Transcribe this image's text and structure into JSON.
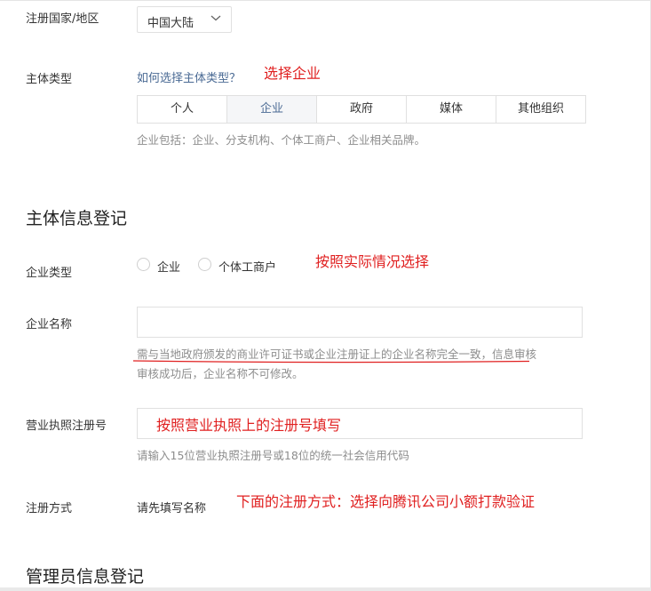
{
  "region": {
    "label": "注册国家/地区",
    "selected": "中国大陆",
    "chevron_icon": "chevron-down-icon"
  },
  "entity_type": {
    "label": "主体类型",
    "help_link": "如何选择主体类型？",
    "options": [
      "个人",
      "企业",
      "政府",
      "媒体",
      "其他组织"
    ],
    "selected": "企业",
    "hint": "企业包括：企业、分支机构、个体工商户、企业相关品牌。"
  },
  "registration": {
    "section_title": "主体信息登记",
    "company_type": {
      "label": "企业类型",
      "options": [
        "企业",
        "个体工商户"
      ]
    },
    "company_name": {
      "label": "企业名称",
      "value": "",
      "hint_line1": "需与当地政府颁发的商业许可证书或企业注册证上的企业名称完全一致，信息审核",
      "hint_line2": "审核成功后，企业名称不可修改。"
    },
    "license_number": {
      "label": "营业执照注册号",
      "value": "",
      "hint": "请输入15位营业执照注册号或18位的统一社会信用代码"
    },
    "method": {
      "label": "注册方式",
      "value": "请先填写名称"
    }
  },
  "admin_section": {
    "title": "管理员信息登记"
  },
  "annotations": {
    "choose_enterprise": "选择企业",
    "choose_by_actual": "按照实际情况选择",
    "fill_by_license": "按照营业执照上的注册号填写",
    "method_note": "下面的注册方式：选择向腾讯公司小额打款验证"
  },
  "colors": {
    "annotation_red": "#e02020",
    "link_blue": "#4a6a94",
    "hint_gray": "#8d8d8d",
    "border": "#e0e0e0"
  }
}
